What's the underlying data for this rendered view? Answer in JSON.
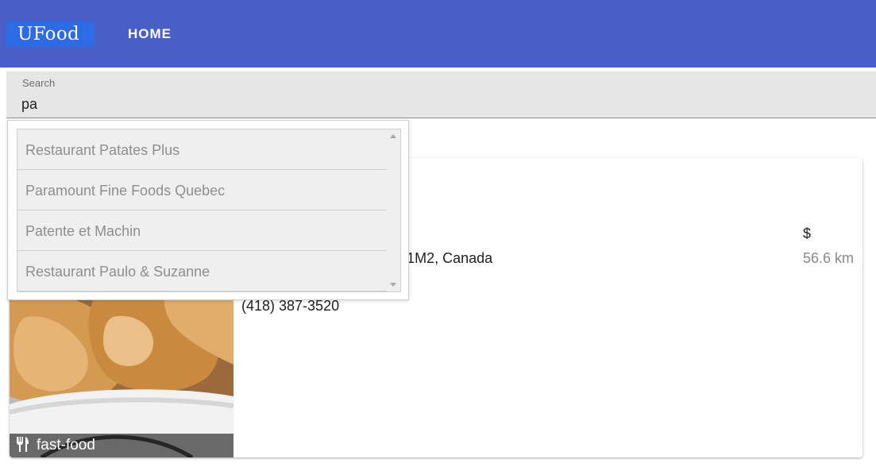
{
  "header": {
    "logo": "UFood",
    "nav_home": "HOME",
    "background_color": "#485fc7",
    "logo_color": "#2d6be4"
  },
  "search": {
    "label": "Search",
    "value": "pa"
  },
  "suggestions": [
    "Restaurant Patates Plus",
    "Paramount Fine Foods Quebec",
    "Patente et Machin",
    "Restaurant Paulo & Suzanne"
  ],
  "restaurant_card": {
    "price": "$",
    "address": "N, Sainte-Marie, QC G6E 1M2, Canada",
    "distance": "56.6 km",
    "phone": "(418) 387-3520",
    "category": "fast-food",
    "category_icon": "fork-knife-icon",
    "image": "fried-chicken-photo"
  }
}
